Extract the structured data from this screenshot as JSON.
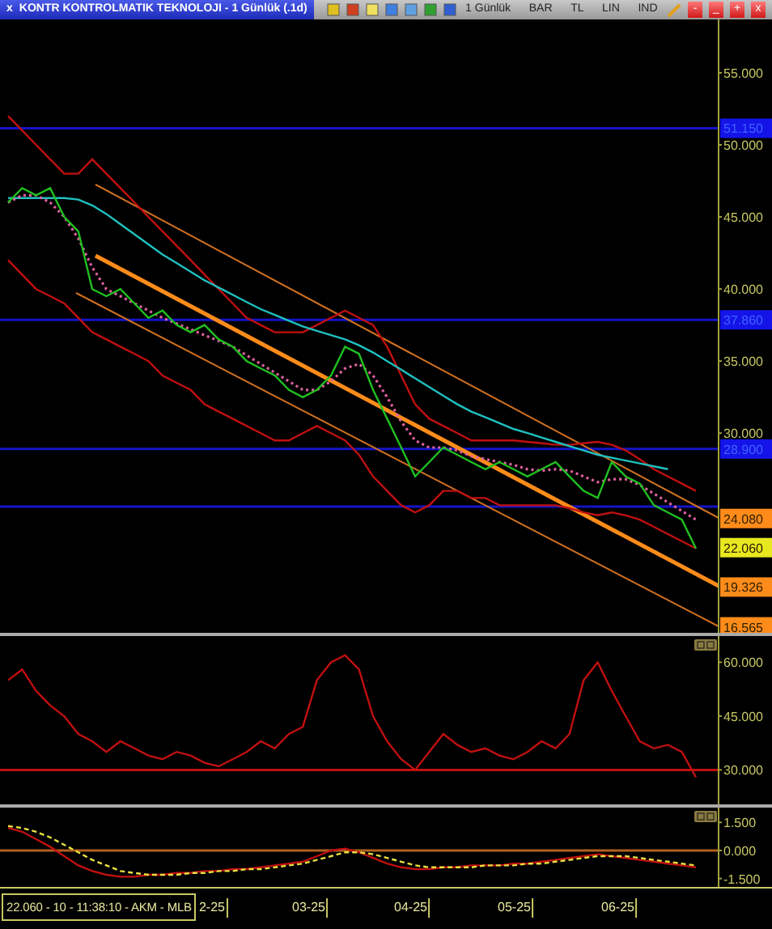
{
  "title_bar": {
    "close_glyph": "x",
    "title": "KONTR KONTROLMATIK TEKNOLOJI - 1 Günlük (.1d)",
    "menu_items": [
      "1 Günlük",
      "BAR",
      "TL",
      "LIN",
      "IND"
    ],
    "window_controls": [
      "-",
      "_",
      "+",
      "x"
    ]
  },
  "price_pane": {
    "chart_data": {
      "type": "line",
      "ylim": [
        16.15,
        58.7
      ],
      "yticks": [
        {
          "value": 55,
          "label": "55.000"
        },
        {
          "value": 50,
          "label": "50.000"
        },
        {
          "value": 45,
          "label": "45.000"
        },
        {
          "value": 40,
          "label": "40.000"
        },
        {
          "value": 35,
          "label": "35.000"
        },
        {
          "value": 30,
          "label": "30.000"
        }
      ],
      "series": [
        {
          "color": "#c01010",
          "values": [
            52,
            51,
            50,
            49,
            48,
            48,
            49,
            48,
            47,
            46,
            45,
            44,
            43,
            42,
            41,
            40,
            39,
            38,
            37.5,
            37,
            37,
            37,
            37.5,
            38,
            38.5,
            38,
            37.5,
            36,
            34,
            32,
            31,
            30.5,
            30,
            29.5,
            29.5,
            29.5,
            29.5,
            29.4,
            29.3,
            29.2,
            29.2,
            29.3,
            29.4,
            29.2,
            28.8,
            28.2,
            27.5,
            27,
            26.5,
            26
          ]
        },
        {
          "color": "#c01010",
          "values": [
            42,
            41,
            40,
            39.5,
            39,
            38,
            37,
            36.5,
            36,
            35.5,
            35,
            34,
            33.5,
            33,
            32,
            31.5,
            31,
            30.5,
            30,
            29.5,
            29.5,
            30,
            30.5,
            30,
            29.5,
            28.5,
            27,
            26,
            25,
            24.5,
            25,
            26,
            26,
            25.5,
            25.5,
            25,
            25,
            25,
            25,
            25,
            24.8,
            24.5,
            24.3,
            24.5,
            24.3,
            24,
            23.5,
            23,
            22.5,
            22
          ]
        },
        {
          "color": "#20c0c0",
          "values": [
            46.3,
            46.3,
            46.3,
            46.3,
            46.3,
            46.2,
            45.8,
            45.2,
            44.5,
            43.8,
            43.1,
            42.4,
            41.8,
            41.2,
            40.6,
            40.1,
            39.6,
            39.1,
            38.6,
            38.2,
            37.8,
            37.4,
            37.1,
            36.8,
            36.5,
            36.1,
            35.6,
            35,
            34.4,
            33.8,
            33.2,
            32.6,
            32,
            31.5,
            31.1,
            30.7,
            30.3,
            30,
            29.7,
            29.4,
            29.1,
            28.8,
            28.5,
            28.3,
            28.1,
            27.9,
            27.7,
            27.5,
            null,
            null
          ]
        },
        {
          "color": "#e060a0",
          "line_style": "dotted",
          "values": [
            46,
            46.5,
            46.5,
            46,
            45,
            43.5,
            41.5,
            40,
            39.5,
            39,
            38.5,
            38,
            37.6,
            37.2,
            36.8,
            36.4,
            36,
            35.4,
            34.8,
            34.2,
            33.6,
            33,
            33,
            33.6,
            34.5,
            34.8,
            34,
            32.5,
            30.8,
            29.5,
            29,
            29,
            28.8,
            28.4,
            28.2,
            28,
            27.8,
            27.5,
            27.4,
            27.5,
            27.4,
            27,
            26.6,
            26.8,
            26.8,
            26.4,
            25.8,
            25.2,
            24.6,
            24
          ]
        },
        {
          "color": "#20c020",
          "values": [
            46,
            47,
            46.5,
            47,
            45,
            44,
            40,
            39.5,
            40,
            39,
            38,
            38.5,
            37.5,
            37,
            37.5,
            36.5,
            36,
            35,
            34.5,
            34,
            33,
            32.5,
            33,
            34,
            36,
            35.5,
            33,
            31,
            29,
            27,
            28,
            29,
            28.5,
            28,
            27.5,
            28,
            27.5,
            27,
            27.5,
            28,
            27,
            26,
            25.5,
            28,
            27,
            26.5,
            25,
            24.5,
            24,
            22
          ]
        }
      ],
      "ref_lines": [
        {
          "axis": "y",
          "value": 51.15,
          "color": "#1414c8",
          "label": "51.150"
        },
        {
          "axis": "y",
          "value": 37.86,
          "color": "#1414c8",
          "label": "37.860"
        },
        {
          "axis": "y",
          "value": 28.9,
          "color": "#1414c8",
          "label": "28.900"
        },
        {
          "axis": "y",
          "value": 24.9,
          "color": "#1414c8"
        }
      ]
    },
    "axis_labels": [
      {
        "label": "24.080",
        "color": "#ff8c1a"
      },
      {
        "label": "22.060",
        "color": "#e8e820"
      },
      {
        "label": "19.326",
        "color": "#ff8c1a"
      },
      {
        "label": "16.565",
        "color": "#ff8c1a"
      }
    ]
  },
  "rsi_pane": {
    "chart_data": {
      "type": "line",
      "ylim": [
        19.5,
        67.3
      ],
      "yticks": [
        {
          "value": 60,
          "label": "60.000"
        },
        {
          "value": 45,
          "label": "45.000"
        },
        {
          "value": 30,
          "label": "30.000"
        }
      ],
      "series": [
        {
          "color": "#c01010",
          "values": [
            55,
            58,
            52,
            48,
            45,
            40,
            38,
            35,
            38,
            36,
            34,
            33,
            35,
            34,
            32,
            31,
            33,
            35,
            38,
            36,
            40,
            42,
            55,
            60,
            62,
            58,
            45,
            38,
            33,
            30,
            35,
            40,
            37,
            35,
            36,
            34,
            33,
            35,
            38,
            36,
            40,
            55,
            60,
            52,
            45,
            38,
            36,
            37,
            35,
            28
          ]
        }
      ],
      "ref_lines": [
        {
          "axis": "y",
          "value": 30,
          "color": "#c01010"
        }
      ]
    }
  },
  "macd_pane": {
    "chart_data": {
      "type": "line",
      "ylim": [
        -2.12,
        2.29
      ],
      "yticks": [
        {
          "value": 1.5,
          "label": "1.500"
        },
        {
          "value": 0,
          "label": "0.000"
        },
        {
          "value": -1.5,
          "label": "-1.500"
        }
      ],
      "series": [
        {
          "color": "#c01010",
          "values": [
            1.2,
            1,
            0.6,
            0.2,
            -0.3,
            -0.8,
            -1.1,
            -1.3,
            -1.4,
            -1.4,
            -1.3,
            -1.3,
            -1.2,
            -1.2,
            -1.1,
            -1.1,
            -1,
            -1,
            -0.9,
            -0.8,
            -0.7,
            -0.6,
            -0.3,
            0,
            0.1,
            -0.1,
            -0.4,
            -0.7,
            -0.9,
            -1,
            -1,
            -0.9,
            -0.9,
            -0.8,
            -0.8,
            -0.8,
            -0.7,
            -0.7,
            -0.6,
            -0.5,
            -0.4,
            -0.3,
            -0.2,
            -0.3,
            -0.4,
            -0.5,
            -0.6,
            -0.7,
            -0.8,
            -0.9
          ]
        },
        {
          "color": "#e8e040",
          "line_style": "dashed",
          "values": [
            1.3,
            1.2,
            1,
            0.7,
            0.3,
            -0.1,
            -0.5,
            -0.8,
            -1.1,
            -1.2,
            -1.3,
            -1.3,
            -1.3,
            -1.2,
            -1.2,
            -1.1,
            -1.1,
            -1,
            -1,
            -0.9,
            -0.8,
            -0.7,
            -0.5,
            -0.3,
            -0.1,
            -0.1,
            -0.2,
            -0.4,
            -0.6,
            -0.8,
            -0.9,
            -0.9,
            -0.9,
            -0.9,
            -0.8,
            -0.8,
            -0.8,
            -0.7,
            -0.7,
            -0.6,
            -0.5,
            -0.4,
            -0.3,
            -0.3,
            -0.3,
            -0.4,
            -0.5,
            -0.6,
            -0.7,
            -0.8
          ]
        }
      ],
      "ref_lines": [
        {
          "axis": "y",
          "value": 0,
          "color": "#b06020"
        }
      ]
    }
  },
  "status_bar": {
    "quote": "22.060 - 10 - 11:38:10 - AKM - MLB",
    "date_labels": [
      "2-25",
      "03-25",
      "04-25",
      "05-25",
      "06-25"
    ]
  }
}
